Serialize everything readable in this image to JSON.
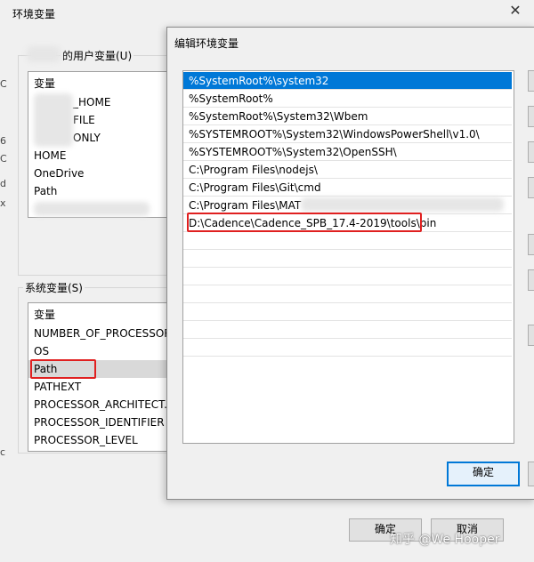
{
  "env_window": {
    "title": "环境变量",
    "user_vars_label": "的用户变量(U)",
    "user_vars_header": "变量",
    "user_vars": [
      {
        "name": "_HOME"
      },
      {
        "name": "FILE"
      },
      {
        "name": "ONLY"
      },
      {
        "name": "HOME"
      },
      {
        "name": "OneDrive"
      },
      {
        "name": "Path"
      }
    ],
    "system_vars_label": "系统变量(S)",
    "system_vars_header": "变量",
    "system_vars": [
      {
        "name": "NUMBER_OF_PROCESSORS"
      },
      {
        "name": "OS"
      },
      {
        "name": "Path"
      },
      {
        "name": "PATHEXT"
      },
      {
        "name": "PROCESSOR_ARCHITECT..."
      },
      {
        "name": "PROCESSOR_IDENTIFIER"
      },
      {
        "name": "PROCESSOR_LEVEL"
      }
    ],
    "ok_label": "确定",
    "cancel_label": "取消"
  },
  "edit_dialog": {
    "title": "编辑环境变量",
    "entries": [
      "%SystemRoot%\\system32",
      "%SystemRoot%",
      "%SystemRoot%\\System32\\Wbem",
      "%SYSTEMROOT%\\System32\\WindowsPowerShell\\v1.0\\",
      "%SYSTEMROOT%\\System32\\OpenSSH\\",
      "C:\\Program Files\\nodejs\\",
      "C:\\Program Files\\Git\\cmd",
      "C:\\Program Files\\MAT",
      "D:\\Cadence\\Cadence_SPB_17.4-2019\\tools\\bin"
    ],
    "ok_label": "确定"
  },
  "watermark": "知乎 @We Hooper",
  "colors": {
    "selection": "#0078d7",
    "highlight_box": "#e02020"
  }
}
